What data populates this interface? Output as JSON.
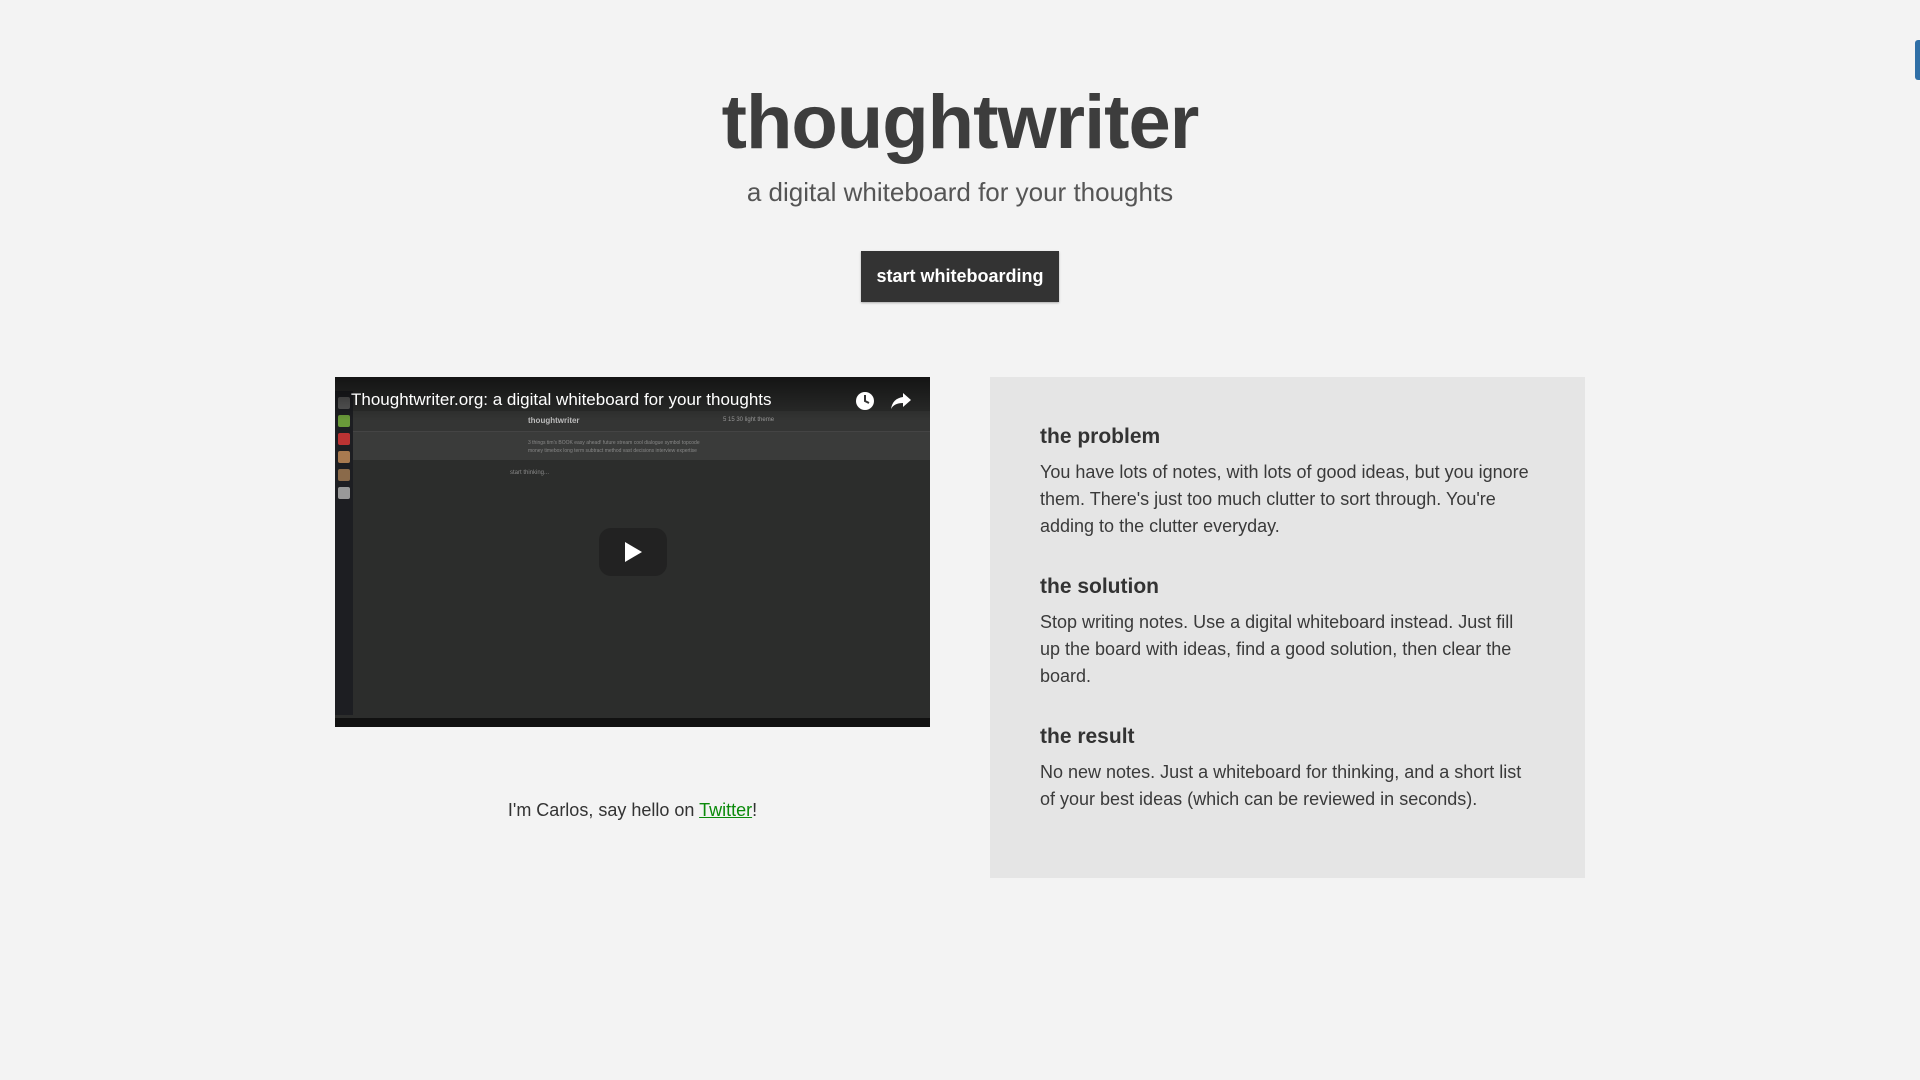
{
  "header": {
    "title": "thoughtwriter",
    "subtitle": "a digital whiteboard for your thoughts",
    "cta_label": "start whiteboarding"
  },
  "video": {
    "title": "Thoughtwriter.org: a digital whiteboard for your thoughts",
    "preview": {
      "app_title": "thoughtwriter",
      "app_meta": "5 15 30     light theme",
      "tag_line_1": "3 things  tim's  BOOK  easy  ahead!  future  stream  cool  dialogue  symbol  topcode",
      "tag_line_2": "money  timebox  long term  subtract  method  vast  decisions  interview  expertise",
      "placeholder": "start thinking..."
    }
  },
  "about": {
    "prefix": "I'm Carlos, say hello on ",
    "link_label": "Twitter",
    "suffix": "!"
  },
  "sections": [
    {
      "heading": "the problem",
      "body": "You have lots of notes, with lots of good ideas, but you ignore them. There's just too much clutter to sort through. You're adding to the clutter everyday."
    },
    {
      "heading": "the solution",
      "body": "Stop writing notes. Use a digital whiteboard instead. Just fill up the board with ideas, find a good solution, then clear the board."
    },
    {
      "heading": "the result",
      "body": "No new notes. Just a whiteboard for thinking, and a short list of your best ideas (which can be reviewed in seconds)."
    }
  ],
  "colors": {
    "background": "#f3f3f3",
    "button": "#333333",
    "panel": "#e5e5e5",
    "link": "#0a8a0a"
  }
}
